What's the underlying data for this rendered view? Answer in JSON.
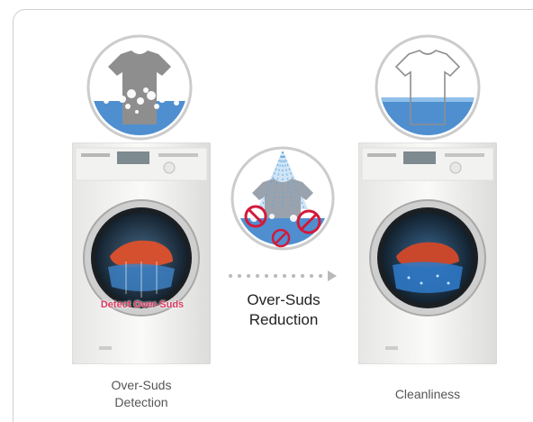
{
  "diagram": {
    "left_caption": [
      "Over-Suds",
      "Detection"
    ],
    "middle_caption": [
      "Over-Suds",
      "Reduction"
    ],
    "right_caption": "Cleanliness",
    "drum_label": "Detect Over-Suds"
  },
  "colors": {
    "water": "#4f8fd0",
    "water_light": "#8fbfea",
    "shirt_dirty": "#8e8e8e",
    "prohibit": "#d3193b",
    "drum_label": "#d93a5e",
    "arrow_dots": "#b9b9b9",
    "frame": "#cfcfcf"
  },
  "icons": [
    "dirty-shirt-icon",
    "spray-shirt-icon",
    "prohibit-icon",
    "clean-shirt-icon"
  ]
}
